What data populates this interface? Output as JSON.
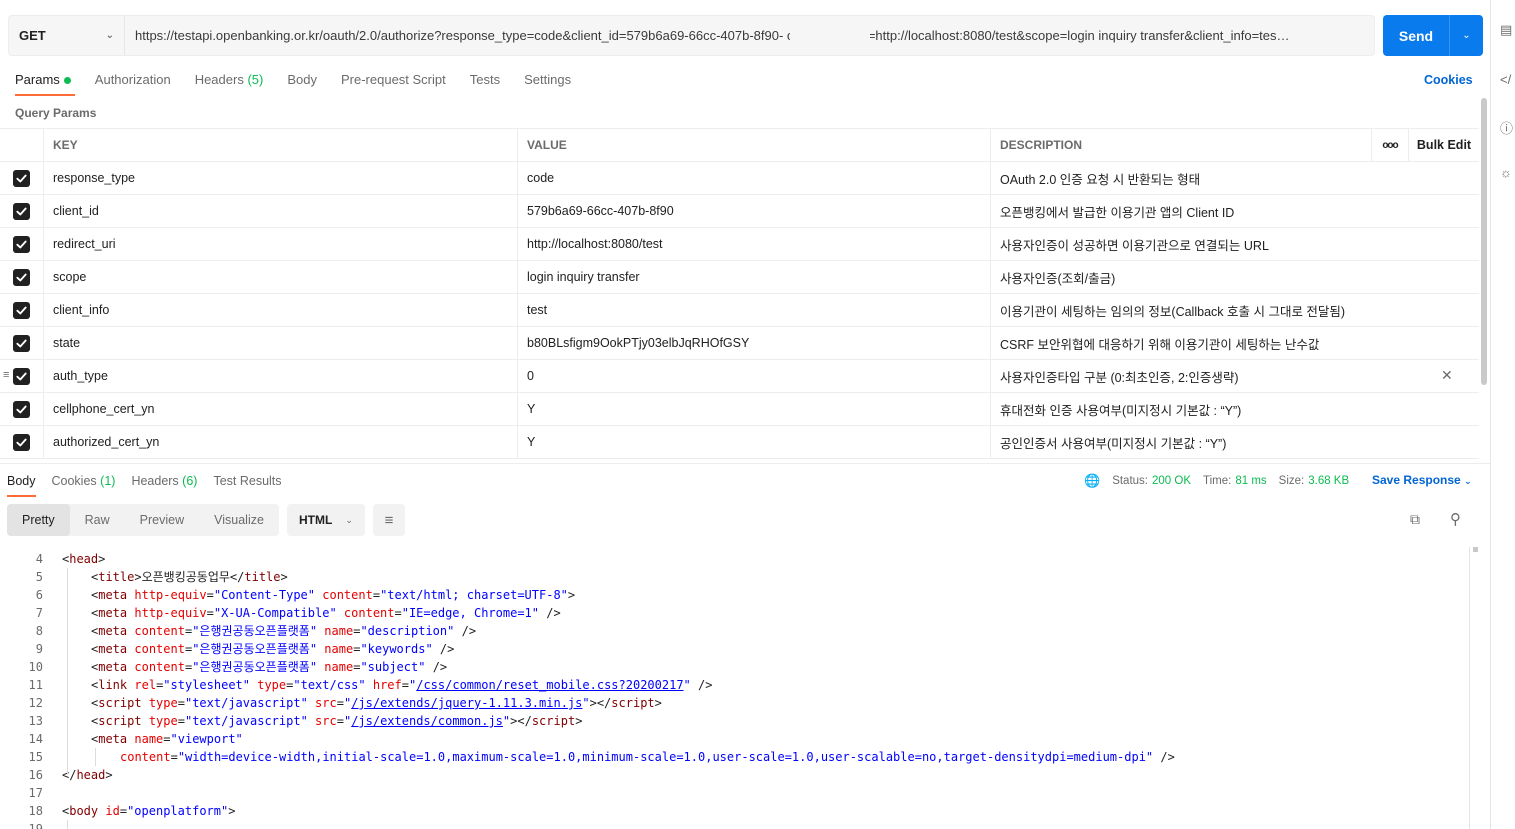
{
  "request": {
    "method": "GET",
    "url": "https://testapi.openbanking.or.kr/oauth/2.0/authorize?response_type=code&client_id=579b6a69-66cc-407b-8f90-          o&redirect_uri=http://localhost:8080/test&scope=login inquiry transfer&client_info=tes…",
    "send_label": "Send"
  },
  "tabs": {
    "params": "Params",
    "authorization": "Authorization",
    "headers": "Headers",
    "headers_count": "(5)",
    "body": "Body",
    "prerequest": "Pre-request Script",
    "tests": "Tests",
    "settings": "Settings",
    "cookies": "Cookies"
  },
  "query_params_title": "Query Params",
  "table": {
    "key_header": "KEY",
    "value_header": "VALUE",
    "description_header": "DESCRIPTION",
    "more_label": "ooo",
    "bulk_edit": "Bulk Edit",
    "rows": [
      {
        "key": "response_type",
        "value": "code",
        "description": "OAuth 2.0 인증 요청 시 반환되는 형태"
      },
      {
        "key": "client_id",
        "value": "579b6a69-66cc-407b-8f90",
        "description": "오픈뱅킹에서 발급한 이용기관 앱의 Client ID"
      },
      {
        "key": "redirect_uri",
        "value": "http://localhost:8080/test",
        "description": "사용자인증이 성공하면 이용기관으로 연결되는 URL"
      },
      {
        "key": "scope",
        "value": "login inquiry transfer",
        "description": "사용자인증(조회/출금)"
      },
      {
        "key": "client_info",
        "value": "test",
        "description": "이용기관이 세팅하는 임의의 정보(Callback 호출 시 그대로 전달됨)"
      },
      {
        "key": "state",
        "value": "b80BLsfigm9OokPTjy03elbJqRHOfGSY",
        "description": "CSRF 보안위협에 대응하기 위해 이용기관이 세팅하는 난수값"
      },
      {
        "key": "auth_type",
        "value": "0",
        "description": "사용자인증타입 구분 (0:최초인증, 2:인증생략)"
      },
      {
        "key": "cellphone_cert_yn",
        "value": "Y",
        "description": "휴대전화 인증 사용여부(미지정시 기본값 : “Y”)"
      },
      {
        "key": "authorized_cert_yn",
        "value": "Y",
        "description": "공인인증서 사용여부(미지정시 기본값 : “Y”)"
      }
    ]
  },
  "response": {
    "tabs": {
      "body": "Body",
      "cookies": "Cookies",
      "cookies_count": "(1)",
      "headers": "Headers",
      "headers_count": "(6)",
      "test_results": "Test Results"
    },
    "status_label": "Status:",
    "status_value": "200 OK",
    "time_label": "Time:",
    "time_value": "81 ms",
    "size_label": "Size:",
    "size_value": "3.68 KB",
    "save_response": "Save Response",
    "view_modes": [
      "Pretty",
      "Raw",
      "Preview",
      "Visualize"
    ],
    "format": "HTML"
  },
  "code": {
    "line_numbers": [
      "4",
      "5",
      "6",
      "7",
      "8",
      "9",
      "10",
      "11",
      "12",
      "13",
      "14",
      "15",
      "16",
      "17",
      "18",
      "19"
    ],
    "title_text": "오픈뱅킹공동업무",
    "meta_desc": "은행권공동오픈플랫폼",
    "viewport_content": "width=device-width,initial-scale=1.0,maximum-scale=1.0,minimum-scale=1.0,user-scale=1.0,user-scalable=no,target-densitydpi=medium-dpi",
    "css_href": "/css/common/reset_mobile.css?20200217",
    "js_jquery": "/js/extends/jquery-1.11.3.min.js",
    "js_common": "/js/extends/common.js",
    "body_id": "openplatform"
  }
}
